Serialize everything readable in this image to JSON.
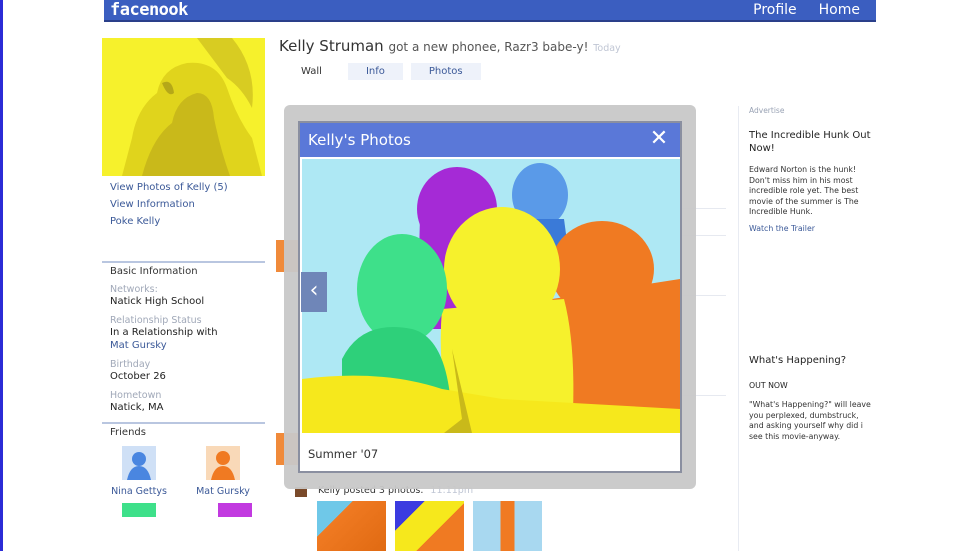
{
  "header": {
    "logo": "facenook",
    "nav": [
      "Profile",
      "Home"
    ]
  },
  "profile": {
    "name": "Kelly Struman",
    "status": "got a new phonee, Razr3 babe-y!",
    "status_time": "Today",
    "tabs": [
      "Wall",
      "Info",
      "Photos"
    ],
    "links": [
      "View Photos of Kelly (5)",
      "View Information",
      "Poke Kelly"
    ]
  },
  "basic_info": {
    "heading": "Basic Information",
    "networks_label": "Networks:",
    "networks": "Natick High School",
    "relationship_label": "Relationship Status",
    "relationship": "In a Relationship with",
    "relationship_with": "Mat Gursky",
    "birthday_label": "Birthday",
    "birthday": "October 26",
    "hometown_label": "Hometown",
    "hometown": "Natick, MA"
  },
  "friends": {
    "heading": "Friends",
    "items": [
      {
        "name": "Nina Gettys",
        "color": "#5a9ae8"
      },
      {
        "name": "Mat Gursky",
        "color": "#f08a3a"
      }
    ]
  },
  "modal": {
    "title": "Kelly's Photos",
    "caption": "Summer '07",
    "close_icon": "close-icon",
    "prev_icon": "chevron-left-icon"
  },
  "feed": {
    "posted_text": "Kelly posted 3 photos.",
    "posted_time": "11:11pm"
  },
  "ads": {
    "label": "Advertise",
    "ad1_title": "The Incredible Hunk Out Now!",
    "ad1_body": "Edward Norton is the hunk! Don't miss him in his most incredible role yet. The best movie of the summer is The Incredible Hunk.",
    "ad1_link": "Watch the Trailer",
    "ad2_title": "What's Happening?",
    "ad2_sub": "OUT NOW",
    "ad2_body": "\"What's Happening?\" will leave you perplexed, dumbstruck, and asking yourself why did i see this movie-anyway."
  },
  "colors": {
    "brand": "#3b5ec0",
    "modal_header": "#5a78d8",
    "link": "#3b5998"
  }
}
